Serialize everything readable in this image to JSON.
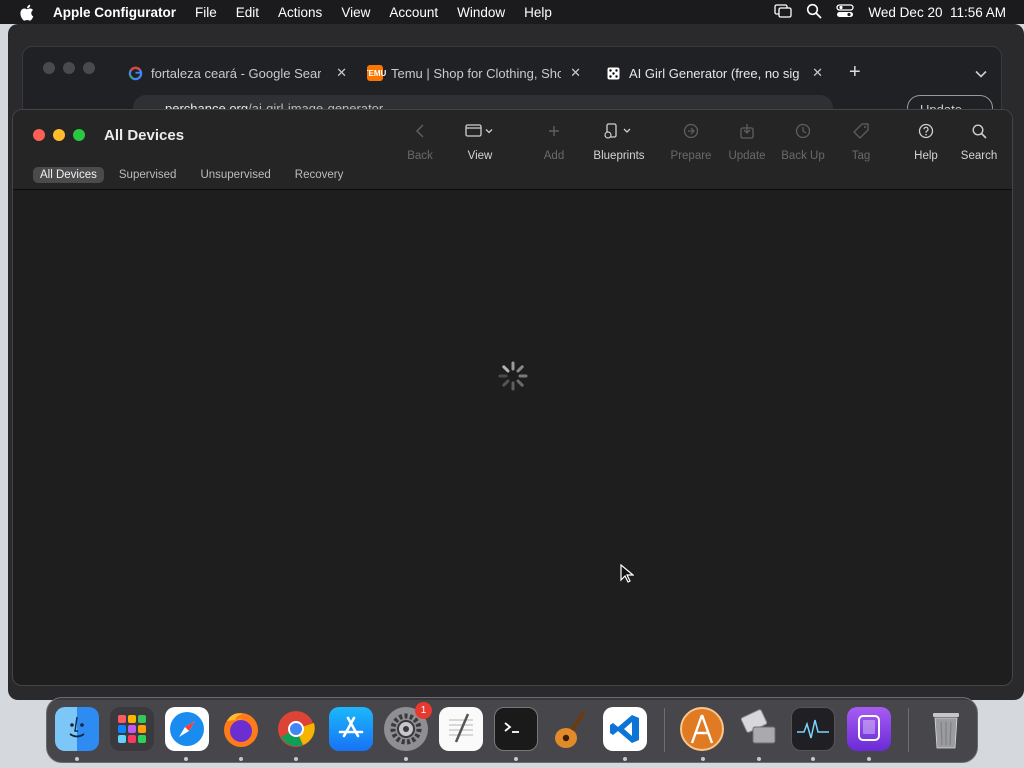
{
  "menubar": {
    "app_name": "Apple Configurator",
    "menus": [
      "File",
      "Edit",
      "Actions",
      "View",
      "Account",
      "Window",
      "Help"
    ],
    "clock": "Wed Dec 20  11:56 AM"
  },
  "browser": {
    "tabs": [
      {
        "title": "fortaleza ceará - Google Search",
        "favicon": "google-icon"
      },
      {
        "title": "Temu | Shop for Clothing, Shoes",
        "favicon": "temu-icon"
      },
      {
        "title": "AI Girl Generator (free, no sign",
        "favicon": "dice-icon"
      }
    ],
    "url_host": "perchance.org",
    "url_path": "/ai-girl-image-generator",
    "update_label": "Update"
  },
  "configurator": {
    "title": "All Devices",
    "toolbar": [
      {
        "name": "back",
        "label": "Back",
        "enabled": false
      },
      {
        "name": "view",
        "label": "View",
        "enabled": true
      },
      {
        "name": "add",
        "label": "Add",
        "enabled": false
      },
      {
        "name": "blueprints",
        "label": "Blueprints",
        "enabled": true
      },
      {
        "name": "prepare",
        "label": "Prepare",
        "enabled": false
      },
      {
        "name": "update",
        "label": "Update",
        "enabled": false
      },
      {
        "name": "back-up",
        "label": "Back Up",
        "enabled": false
      },
      {
        "name": "tag",
        "label": "Tag",
        "enabled": false
      },
      {
        "name": "help",
        "label": "Help",
        "enabled": true
      },
      {
        "name": "search",
        "label": "Search",
        "enabled": true
      }
    ],
    "filters": [
      "All Devices",
      "Supervised",
      "Unsupervised",
      "Recovery"
    ],
    "selected_filter": "All Devices",
    "state": "loading"
  },
  "dock": {
    "apps": [
      "Finder",
      "Launchpad",
      "Safari",
      "Firefox",
      "Google Chrome",
      "App Store",
      "System Settings",
      "TextEdit",
      "Terminal",
      "GarageBand",
      "Visual Studio Code",
      "Apple Configurator",
      "Migration Assistant",
      "Activity Monitor",
      "Simulator",
      "Trash"
    ],
    "settings_badge": "1"
  }
}
